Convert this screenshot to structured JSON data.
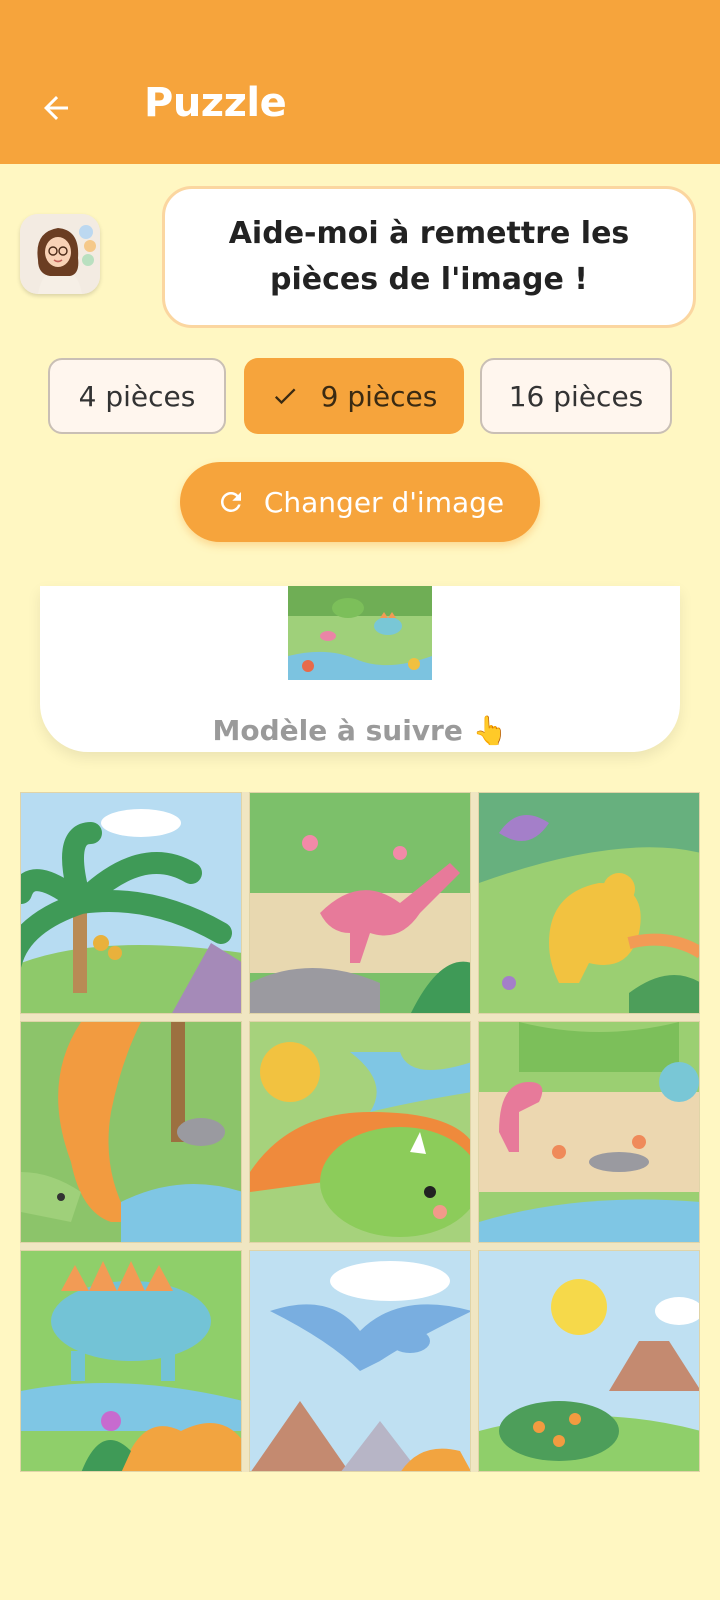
{
  "appbar": {
    "title": "Puzzle",
    "back_icon": "arrow-left-icon",
    "color": "#F6A43C"
  },
  "assistant": {
    "avatar_icon": "teacher-avatar-icon",
    "message": "Aide-moi à remettre les pièces de l'image !"
  },
  "difficulty": {
    "options": [
      {
        "label": "4 pièces",
        "selected": false
      },
      {
        "label": "9 pièces",
        "selected": true
      },
      {
        "label": "16 pièces",
        "selected": false
      }
    ],
    "check_icon": "check-icon"
  },
  "change_image": {
    "label": "Changer d'image",
    "icon": "refresh-icon"
  },
  "model": {
    "caption": "Modèle à suivre 👆",
    "thumbnail": "dinosaur-landscape-thumbnail"
  },
  "puzzle": {
    "rows": 3,
    "cols": 3,
    "tiles": [
      {
        "id": 1,
        "description_icon": "palm-tree-icon"
      },
      {
        "id": 2,
        "description_icon": "pink-dinosaur-icon"
      },
      {
        "id": 3,
        "description_icon": "yellow-dinosaur-icon"
      },
      {
        "id": 4,
        "description_icon": "orange-dinosaur-neck-icon"
      },
      {
        "id": 5,
        "description_icon": "triceratops-icon"
      },
      {
        "id": 6,
        "description_icon": "path-dinosaurs-icon"
      },
      {
        "id": 7,
        "description_icon": "stegosaurus-icon"
      },
      {
        "id": 8,
        "description_icon": "pterodactyl-icon"
      },
      {
        "id": 9,
        "description_icon": "sun-volcano-icon"
      }
    ]
  },
  "colors": {
    "background": "#FFF7C2",
    "accent": "#F6A43C",
    "bubble_border": "#FBD6A0"
  }
}
